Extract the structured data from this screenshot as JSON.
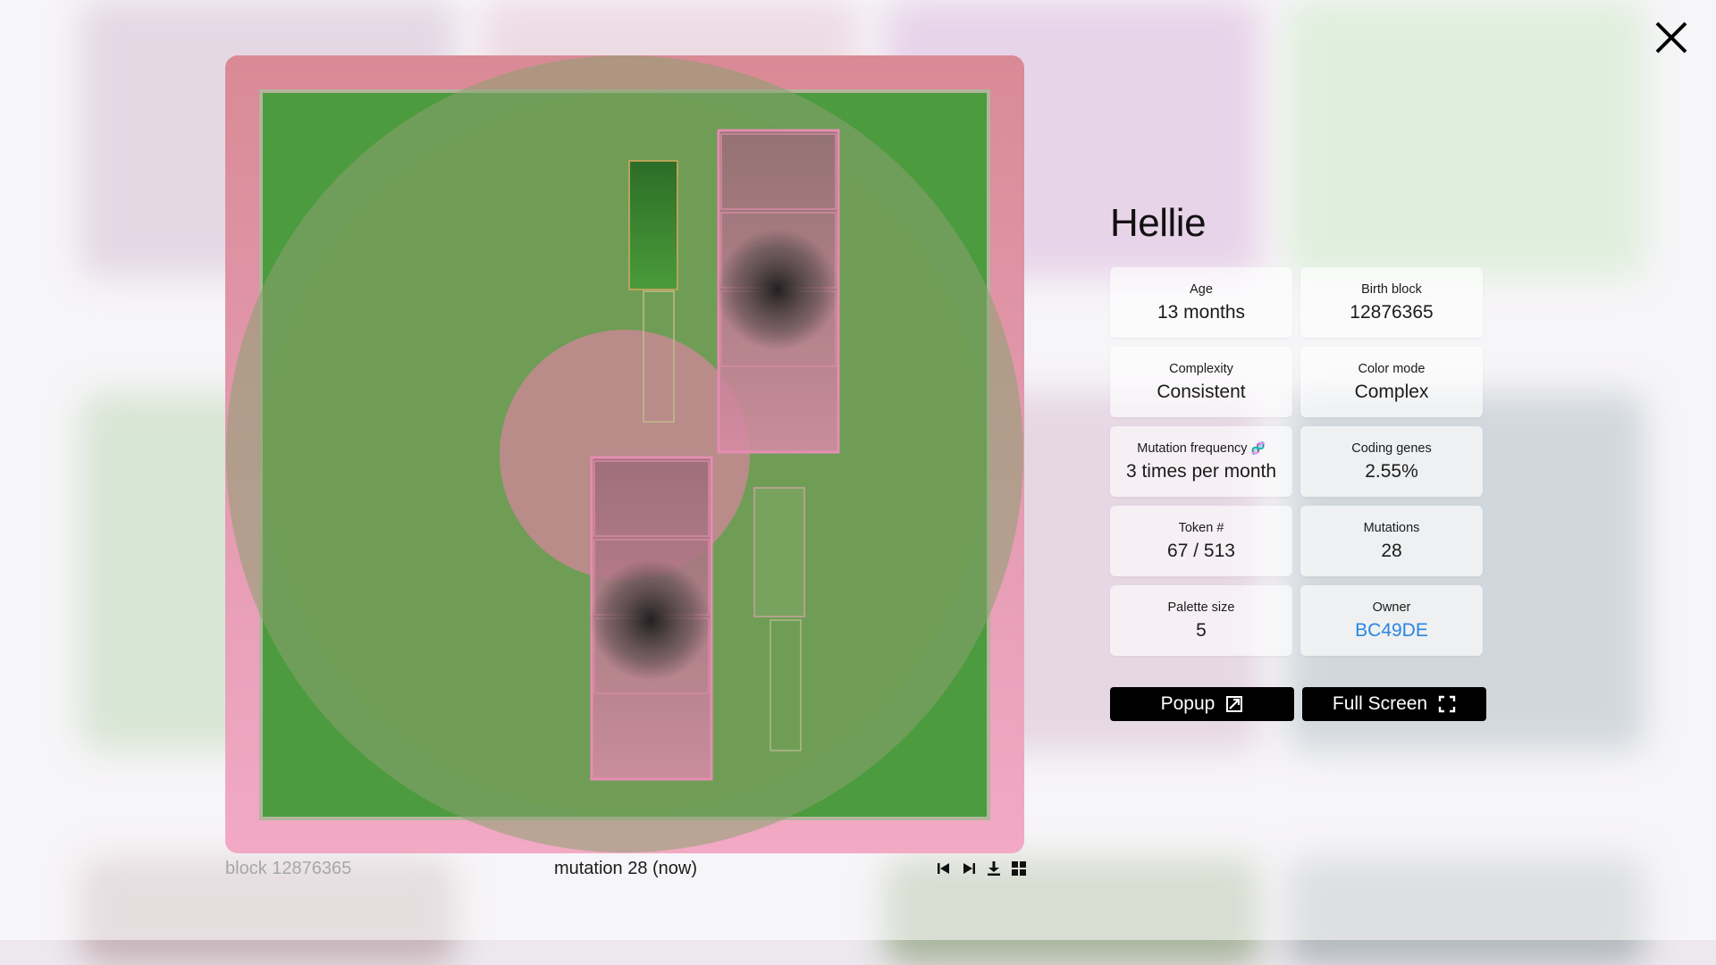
{
  "token": {
    "name": "Hellie",
    "stats": [
      {
        "id": "age",
        "label": "Age",
        "value": "13 months"
      },
      {
        "id": "birth-block",
        "label": "Birth block",
        "value": "12876365"
      },
      {
        "id": "complexity",
        "label": "Complexity",
        "value": "Consistent"
      },
      {
        "id": "color-mode",
        "label": "Color mode",
        "value": "Complex"
      },
      {
        "id": "mutation-frequency",
        "label": "Mutation frequency",
        "value": "3 times per month"
      },
      {
        "id": "coding-genes",
        "label": "Coding genes",
        "value": "2.55%"
      },
      {
        "id": "token-number",
        "label": "Token #",
        "value": "67 / 513"
      },
      {
        "id": "mutations",
        "label": "Mutations",
        "value": "28"
      },
      {
        "id": "palette-size",
        "label": "Palette size",
        "value": "5"
      },
      {
        "id": "owner",
        "label": "Owner",
        "value": "BC49DE"
      }
    ]
  },
  "actions": {
    "popup_label": "Popup",
    "fullscreen_label": "Full Screen"
  },
  "viewer": {
    "block_caption": "block 12876365",
    "mutation_caption": "mutation 28 (now)"
  },
  "icons": {
    "close": "close-icon",
    "mutation_frequency": "dna-icon",
    "popup": "expand-arrow-icon",
    "fullscreen": "fullscreen-corners-icon",
    "controls": [
      "skip-to-start-icon",
      "step-forward-icon",
      "download-icon",
      "grid-icon"
    ]
  },
  "colors": {
    "owner_link": "#2a86e0",
    "button_bg": "#000000",
    "art_frame": "#e49bb2",
    "art_green": "#4c9b3e"
  }
}
